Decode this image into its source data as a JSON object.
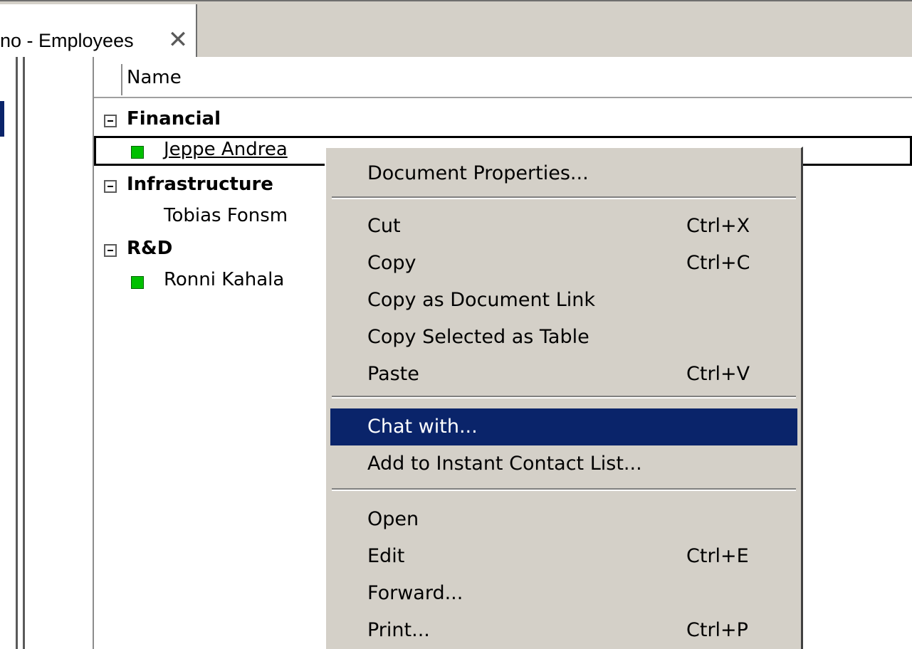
{
  "tab": {
    "title": "no - Employees",
    "close_icon": "close-icon"
  },
  "view": {
    "column_name": "Name",
    "groups": [
      {
        "label": "Financial",
        "people": [
          {
            "name": "Jeppe Andrea",
            "status_color": "#00c000"
          }
        ]
      },
      {
        "label": "Infrastructure",
        "people": [
          {
            "name": "Tobias Fonsm"
          }
        ]
      },
      {
        "label": "R&D",
        "people": [
          {
            "name": "Ronni Kahala",
            "status_color": "#00c000"
          }
        ]
      }
    ]
  },
  "context_menu": {
    "items": [
      {
        "label": "Document Properties...",
        "shortcut": ""
      },
      {
        "label": "Cut",
        "shortcut": "Ctrl+X"
      },
      {
        "label": "Copy",
        "shortcut": "Ctrl+C"
      },
      {
        "label": "Copy as Document Link",
        "shortcut": ""
      },
      {
        "label": "Copy Selected as Table",
        "shortcut": ""
      },
      {
        "label": "Paste",
        "shortcut": "Ctrl+V"
      },
      {
        "label": "Chat with...",
        "shortcut": "",
        "highlighted": true
      },
      {
        "label": "Add to Instant Contact List...",
        "shortcut": ""
      },
      {
        "label": "Open",
        "shortcut": ""
      },
      {
        "label": "Edit",
        "shortcut": "Ctrl+E"
      },
      {
        "label": "Forward...",
        "shortcut": ""
      },
      {
        "label": "Print...",
        "shortcut": "Ctrl+P"
      }
    ]
  },
  "colors": {
    "menu_bg": "#d4d0c8",
    "highlight": "#0a246a",
    "status_online": "#00c000"
  }
}
